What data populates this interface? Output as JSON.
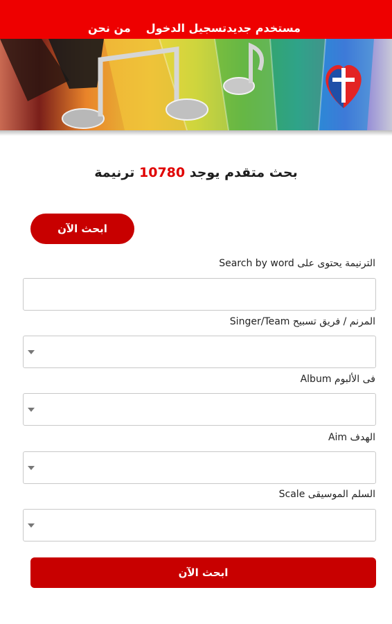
{
  "nav": {
    "items": [
      {
        "label": "مستخدم جديد"
      },
      {
        "label": "تسجيل الدخول"
      },
      {
        "label": "من نحن"
      }
    ]
  },
  "banner": {
    "logo_icon": "cross-heart-logo",
    "image": "piano-music-notes"
  },
  "heading": {
    "prefix": "بحث متقدم يوجد",
    "count": "10780",
    "suffix": "ترنيمة"
  },
  "search_top_button": "ابحث الآن",
  "fields": {
    "word": {
      "label": "الترنيمة يحتوى على Search by word",
      "value": ""
    },
    "singer": {
      "label": "المرنم / فريق تسبيح Singer/Team",
      "value": ""
    },
    "album": {
      "label": "فى الألبوم Album",
      "value": ""
    },
    "aim": {
      "label": "الهدف Aim",
      "value": ""
    },
    "scale": {
      "label": "السلم الموسيقى Scale",
      "value": ""
    }
  },
  "search_bottom_button": "ابحث الآن",
  "colors": {
    "accent": "#ee0000",
    "button": "#c80000"
  }
}
